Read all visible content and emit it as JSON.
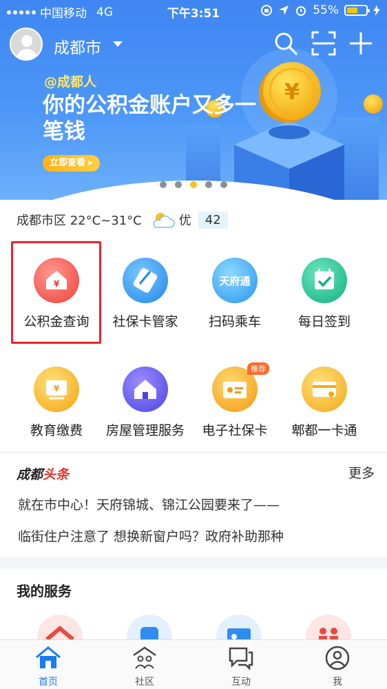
{
  "status_bar": {
    "carrier": "中国移动",
    "network": "4G",
    "time": "下午3:51",
    "battery": "55%"
  },
  "header": {
    "city": "成都市"
  },
  "banner": {
    "tag": "@成都人",
    "title": "你的公积金账户又多一笔钱",
    "button": "立即查看"
  },
  "weather": {
    "text": "成都市区 22°C~31°C",
    "quality": "优",
    "aqi": "42"
  },
  "grid": [
    {
      "label": "公积金查询",
      "icon": "housing-fund-icon",
      "color": "#f0584f"
    },
    {
      "label": "社保卡管家",
      "icon": "social-card-icon",
      "color": "#2f98f0"
    },
    {
      "label": "扫码乘车",
      "icon": "tianfutong-icon",
      "color": "#36a6f5"
    },
    {
      "label": "每日签到",
      "icon": "calendar-check-icon",
      "color": "#22c08f"
    },
    {
      "label": "教育缴费",
      "icon": "education-pay-icon",
      "color": "#f7b11e"
    },
    {
      "label": "房屋管理服务",
      "icon": "house-icon",
      "color": "#6a62f0"
    },
    {
      "label": "电子社保卡",
      "icon": "e-social-card-icon",
      "color": "#f7a824"
    },
    {
      "label": "郫都一卡通",
      "icon": "pidu-card-icon",
      "color": "#f7b523"
    }
  ],
  "grid_badge": "推荐",
  "news": {
    "logo_a": "成都",
    "logo_b": "头条",
    "more": "更多",
    "items": [
      "就在市中心！天府锦城、锦江公园要来了——",
      "临街住户注意了 想换新窗户吗？政府补助那种"
    ]
  },
  "services": {
    "title": "我的服务"
  },
  "tabs": [
    {
      "label": "首页",
      "icon": "home-icon"
    },
    {
      "label": "社区",
      "icon": "community-icon"
    },
    {
      "label": "互动",
      "icon": "chat-icon"
    },
    {
      "label": "我",
      "icon": "profile-icon"
    }
  ],
  "colors": {
    "accent": "#1a7cf2",
    "highlight": "#e8242a"
  }
}
